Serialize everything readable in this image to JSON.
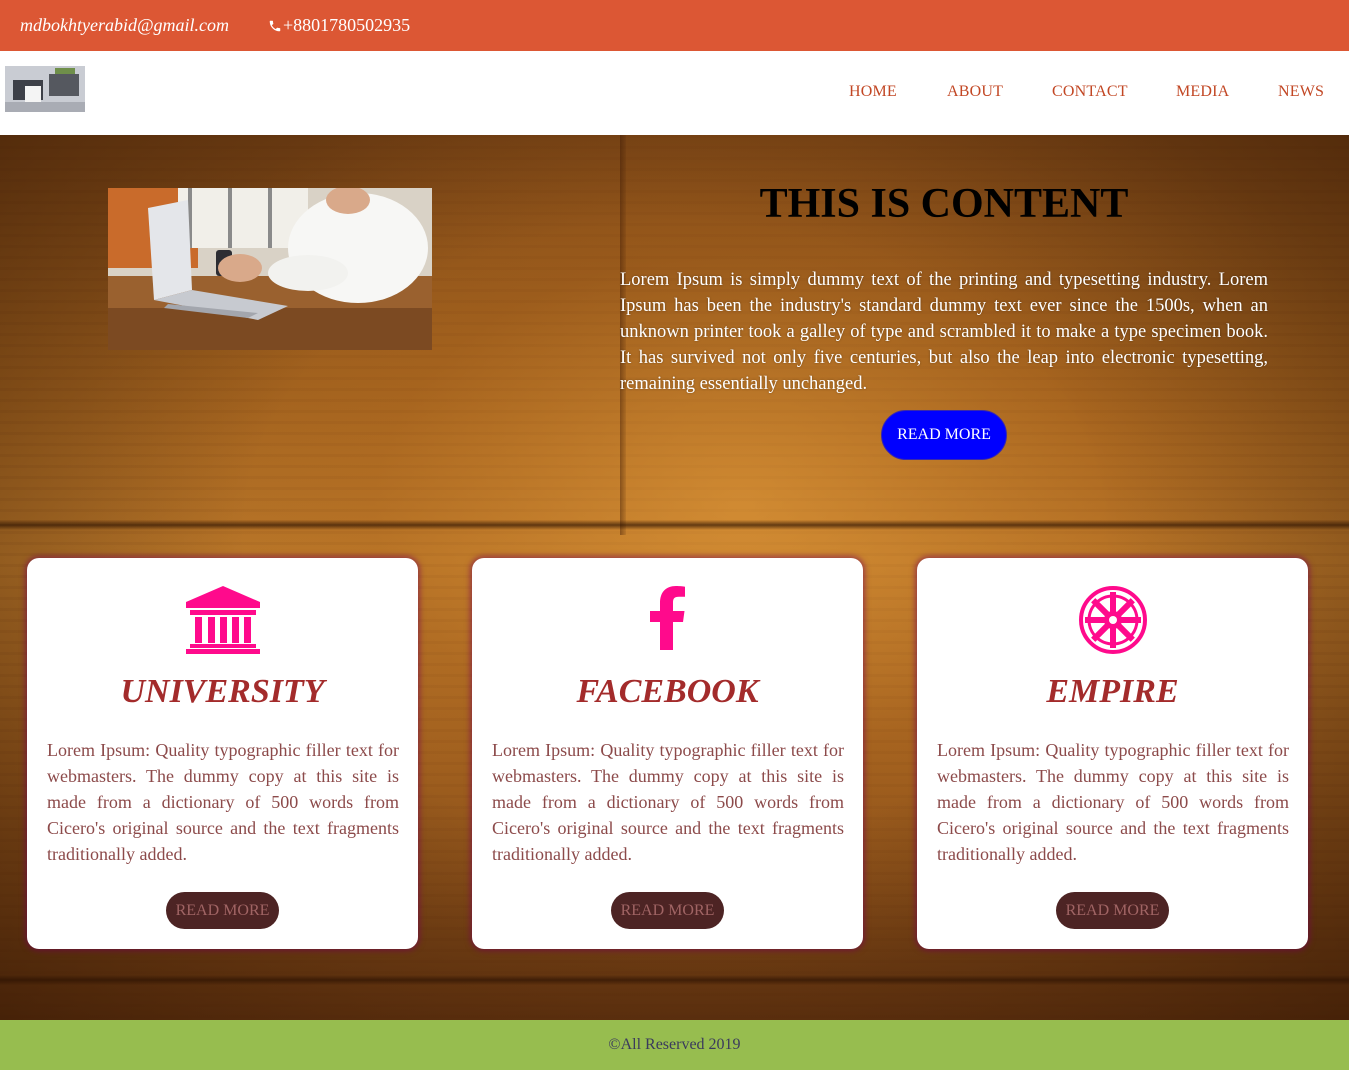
{
  "topbar": {
    "email": "mdbokhtyerabid@gmail.com",
    "phone": "+8801780502935",
    "bg_color": "#dc5734"
  },
  "nav": {
    "items": [
      {
        "label": "HOME"
      },
      {
        "label": "ABOUT"
      },
      {
        "label": "CONTACT"
      },
      {
        "label": "MEDIA"
      },
      {
        "label": "NEWS"
      }
    ],
    "link_color": "#c24724"
  },
  "hero": {
    "title": "THIS IS CONTENT",
    "text": "Lorem Ipsum is simply dummy text of the printing and typesetting industry. Lorem Ipsum has been the industry's standard dummy text ever since the 1500s, when an unknown printer took a galley of type and scrambled it to make a type specimen book. It has survived not only five centuries, but also the leap into electronic typesetting, remaining essentially unchanged.",
    "button_label": "READ MORE",
    "button_color": "#0000ff"
  },
  "cards": [
    {
      "icon": "university-icon",
      "title": "UNIVERSITY",
      "text": "Lorem Ipsum: Quality typographic filler text for webmasters. The dummy copy at this site is made from a dictionary of 500 words from Cicero's original source and the text fragments traditionally added.",
      "button_label": "READ MORE"
    },
    {
      "icon": "facebook-icon",
      "title": "FACEBOOK",
      "text": "Lorem Ipsum: Quality typographic filler text for webmasters. The dummy copy at this site is made from a dictionary of 500 words from Cicero's original source and the text fragments traditionally added.",
      "button_label": "READ MORE"
    },
    {
      "icon": "empire-icon",
      "title": "EMPIRE",
      "text": "Lorem Ipsum: Quality typographic filler text for webmasters. The dummy copy at this site is made from a dictionary of 500 words from Cicero's original source and the text fragments traditionally added.",
      "button_label": "READ MORE"
    }
  ],
  "icon_color": "#ff0a8c",
  "footer": {
    "text": "©All Reserved 2019",
    "bg_color": "#97bd4f"
  }
}
